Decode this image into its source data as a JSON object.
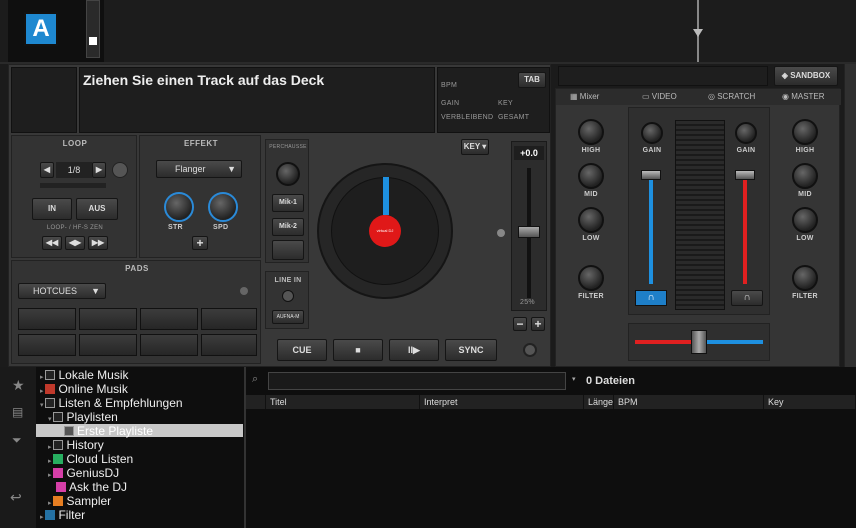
{
  "logo": {
    "letter": "A"
  },
  "deck": {
    "track_title": "Ziehen Sie einen Track auf das Deck",
    "info": {
      "bpm": "BPM",
      "tab": "TAB",
      "gain": "GAIN",
      "key": "KEY",
      "remaining": "VERBLEIBEND",
      "total": "GESAMT"
    },
    "loop": {
      "title": "LOOP",
      "size": "1/8",
      "in": "IN",
      "out": "AUS",
      "sub": "LOOP- / HF-S ZEN"
    },
    "effect": {
      "title": "EFFEKT",
      "selected": "Flanger",
      "str": "STR",
      "spd": "SPD"
    },
    "pads": {
      "title": "PADS",
      "mode": "HOTCUES"
    },
    "side": {
      "label": "PERCHAUSSE",
      "mik1": "Mik-1",
      "mik2": "Mik-2",
      "line_in": "LINE IN",
      "aufnahme": "AUFNA-M"
    },
    "key_button": "KEY",
    "pitch": {
      "value": "+0.0",
      "percent": "25%"
    },
    "transport": {
      "cue": "CUE",
      "stop": "■",
      "play": "II▶",
      "sync": "SYNC"
    },
    "platter_label": "virtual DJ"
  },
  "mixer": {
    "sandbox": "SANDBOX",
    "tabs": [
      "Mixer",
      "VIDEO",
      "SCRATCH",
      "MASTER"
    ],
    "left": {
      "high": "HIGH",
      "mid": "MID",
      "low": "LOW",
      "filter": "FILTER"
    },
    "center": {
      "gain_left": "GAIN",
      "gain_right": "GAIN"
    },
    "right": {
      "high": "HIGH",
      "mid": "MID",
      "low": "LOW",
      "filter": "FILTER"
    },
    "colors": {
      "left": "#1e90e0",
      "right": "#e02020"
    },
    "levels": {
      "left_fader": 1.0,
      "right_fader": 1.0,
      "crossfader": 0.5
    }
  },
  "browser": {
    "tree": [
      {
        "label": "Lokale Musik",
        "icon": "computer-icon",
        "indent": 0
      },
      {
        "label": "Online Musik",
        "icon": "online-icon",
        "indent": 0
      },
      {
        "label": "Listen & Empfehlungen",
        "icon": "list-icon",
        "indent": 0
      },
      {
        "label": "Playlisten",
        "icon": "folder-icon",
        "indent": 1
      },
      {
        "label": "Erste Playliste",
        "icon": "playlist-icon",
        "indent": 2
      },
      {
        "label": "History",
        "icon": "history-icon",
        "indent": 1
      },
      {
        "label": "Cloud Listen",
        "icon": "cloud-icon",
        "indent": 1
      },
      {
        "label": "GeniusDJ",
        "icon": "genius-icon",
        "indent": 1
      },
      {
        "label": "Ask the DJ",
        "icon": "ask-icon",
        "indent": 1
      },
      {
        "label": "Sampler",
        "icon": "sampler-icon",
        "indent": 1
      },
      {
        "label": "Filter",
        "icon": "filter-icon",
        "indent": 0
      }
    ],
    "file_count": "0 Dateien",
    "columns": [
      "Titel",
      "Interpret",
      "Länge",
      "BPM",
      "Key"
    ]
  }
}
